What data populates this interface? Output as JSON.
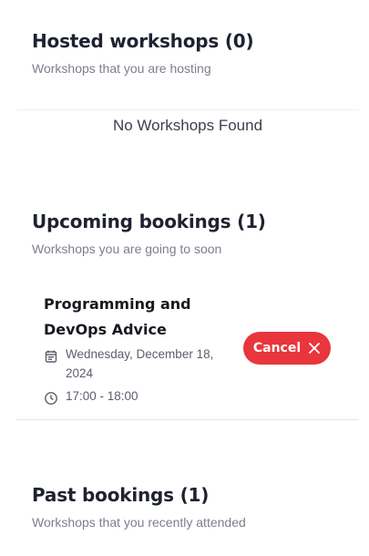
{
  "hosted": {
    "title": "Hosted workshops (0)",
    "subtitle": "Workshops that you are hosting",
    "empty_text": "No Workshops Found"
  },
  "upcoming": {
    "title": "Upcoming bookings (1)",
    "subtitle": "Workshops you are going to soon",
    "items": [
      {
        "title": "Programming and DevOps Advice",
        "date": "Wednesday, December 18, 2024",
        "time": "17:00 - 18:00",
        "cancel_label": "Cancel",
        "date_icon": "calendar-icon",
        "time_icon": "clock-icon",
        "cancel_icon": "close-icon"
      }
    ]
  },
  "past": {
    "title": "Past bookings (1)",
    "subtitle": "Workshops that you recently attended"
  },
  "colors": {
    "accent_red": "#e8363c",
    "heading": "#1e2230",
    "muted": "#7a7f8c"
  }
}
